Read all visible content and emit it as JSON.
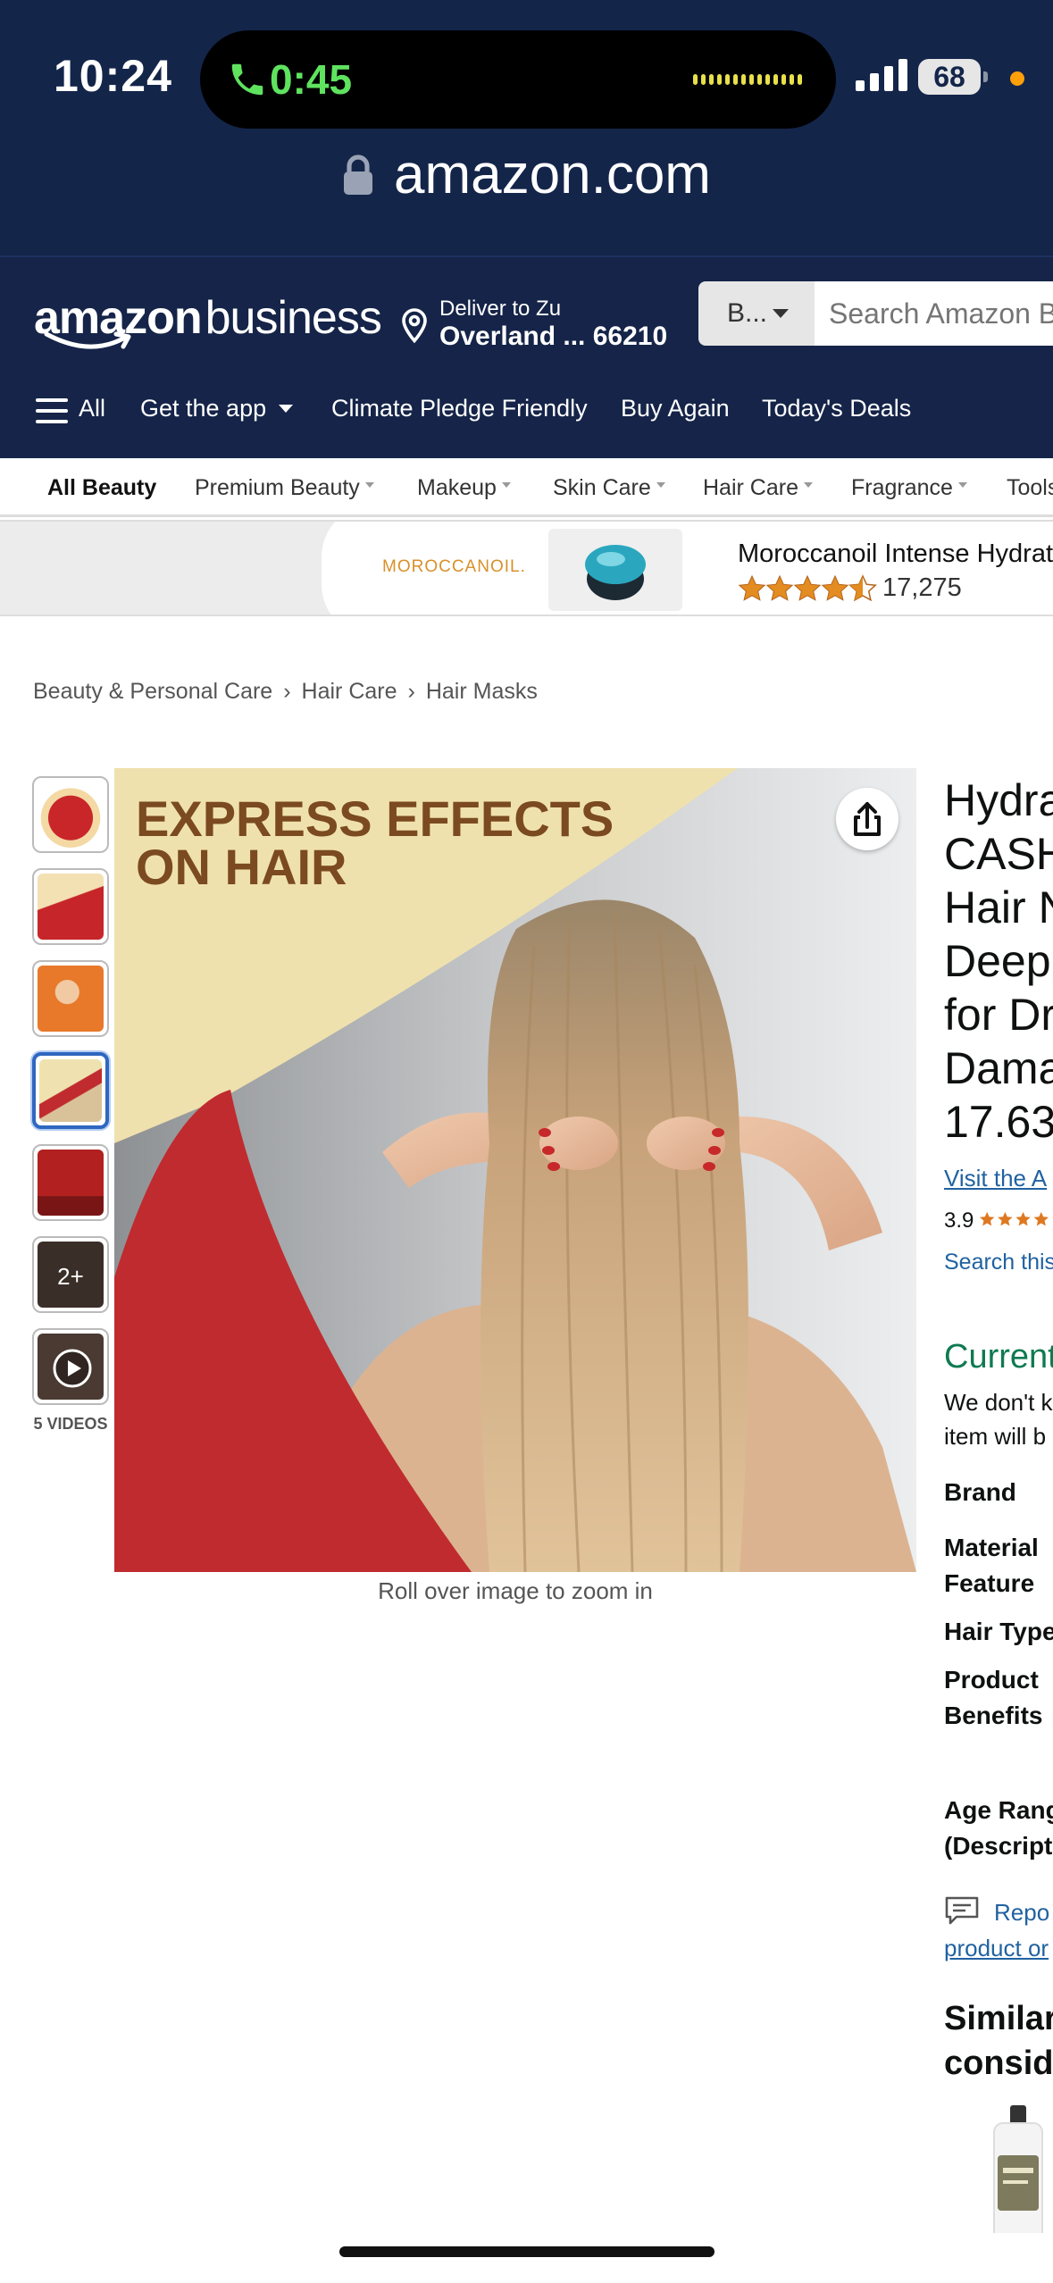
{
  "status_bar": {
    "time": "10:24",
    "call_duration": "0:45",
    "battery": "68"
  },
  "browser": {
    "url": "amazon.com"
  },
  "header": {
    "logo_main": "amazon",
    "logo_sub": "business",
    "deliver_to": "Deliver to Zu",
    "deliver_location": "Overland ... 66210",
    "search_category": "B...",
    "search_placeholder": "Search Amazon B"
  },
  "nav": {
    "all": "All",
    "items": [
      "Get the app",
      "Climate Pledge Friendly",
      "Buy Again",
      "Today's Deals"
    ]
  },
  "categories": [
    "All Beauty",
    "Premium Beauty",
    "Makeup",
    "Skin Care",
    "Hair Care",
    "Fragrance",
    "Tools"
  ],
  "banner": {
    "brand": "MOROCCANOIL.",
    "title": "Moroccanoil Intense Hydrat",
    "rating": 4.5,
    "review_count": "17,275"
  },
  "breadcrumb": [
    "Beauty & Personal Care",
    "Hair Care",
    "Hair Masks"
  ],
  "gallery": {
    "more_label": "2+",
    "videos_label": "5 VIDEOS",
    "headline_line1": "EXPRESS EFFECTS",
    "headline_line2": "ON HAIR",
    "zoom_hint": "Roll over image to zoom in"
  },
  "product": {
    "title_lines": [
      "Hydra",
      "CASH",
      "Hair N",
      "Deep",
      "for Dr",
      "Dama",
      "17.63"
    ],
    "visit_link": "Visit the A",
    "rating": "3.9",
    "search_link": "Search this",
    "availability_heading": "Current",
    "availability_text_1": "We don't k",
    "availability_text_2": "item will b",
    "specs": {
      "brand": "Brand",
      "material_1": "Material",
      "material_2": "Feature",
      "hair_type": "Hair Type",
      "benefits_1": "Product",
      "benefits_2": "Benefits",
      "age_1": "Age Rang",
      "age_2": "(Descript"
    },
    "report_1": "Repo",
    "report_2": "product or",
    "similar_1": "Similar",
    "similar_2": "conside"
  },
  "colors": {
    "header_bg": "#152448",
    "status_bg": "#14254a",
    "link": "#2162a1",
    "availability": "#0f7a52",
    "star": "#de7921"
  }
}
